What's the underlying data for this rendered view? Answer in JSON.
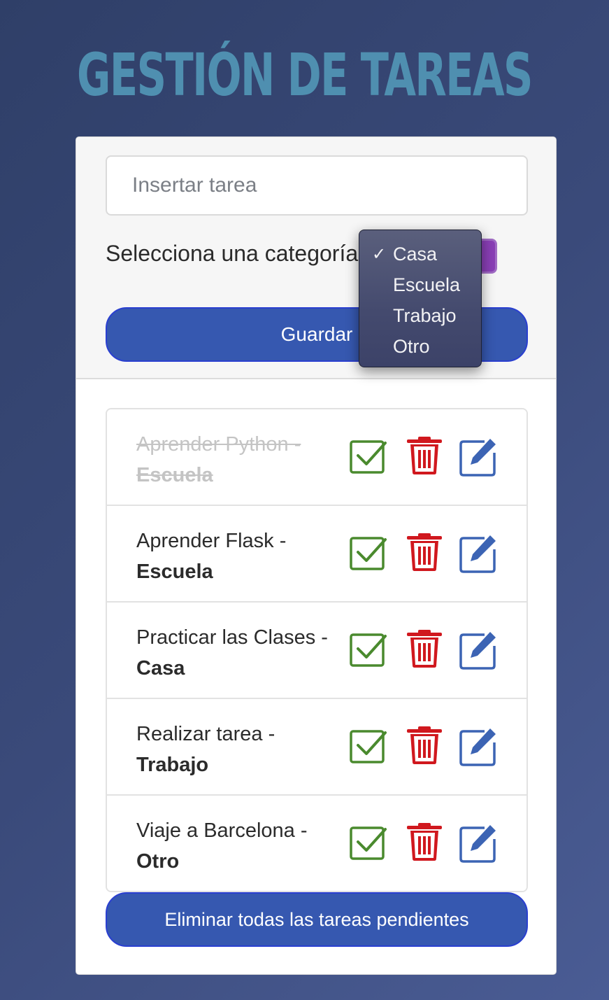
{
  "header": {
    "title": "GESTIÓN DE TAREAS"
  },
  "form": {
    "task_placeholder": "Insertar tarea",
    "category_label": "Selecciona una categoría",
    "save_label": "Guardar"
  },
  "dropdown": {
    "selected": "Casa",
    "options": [
      "Casa",
      "Escuela",
      "Trabajo",
      "Otro"
    ]
  },
  "tasks": [
    {
      "text": "Aprender Python -",
      "category": "Escuela",
      "completed": true
    },
    {
      "text": "Aprender Flask -",
      "category": "Escuela",
      "completed": false
    },
    {
      "text": "Practicar las Clases -",
      "category": "Casa",
      "completed": false
    },
    {
      "text": "Realizar tarea -",
      "category": "Trabajo",
      "completed": false
    },
    {
      "text": "Viaje a Barcelona -",
      "category": "Otro",
      "completed": false
    }
  ],
  "footer": {
    "delete_all_label": "Eliminar todas las tareas pendientes"
  },
  "colors": {
    "accent": "#3658b0",
    "title": "#4f8fb0",
    "check": "#4a8a2e",
    "trash": "#d0181e",
    "edit": "#3c64b4"
  },
  "icons": {
    "complete": "check-square-icon",
    "delete": "trash-icon",
    "edit": "edit-icon"
  }
}
